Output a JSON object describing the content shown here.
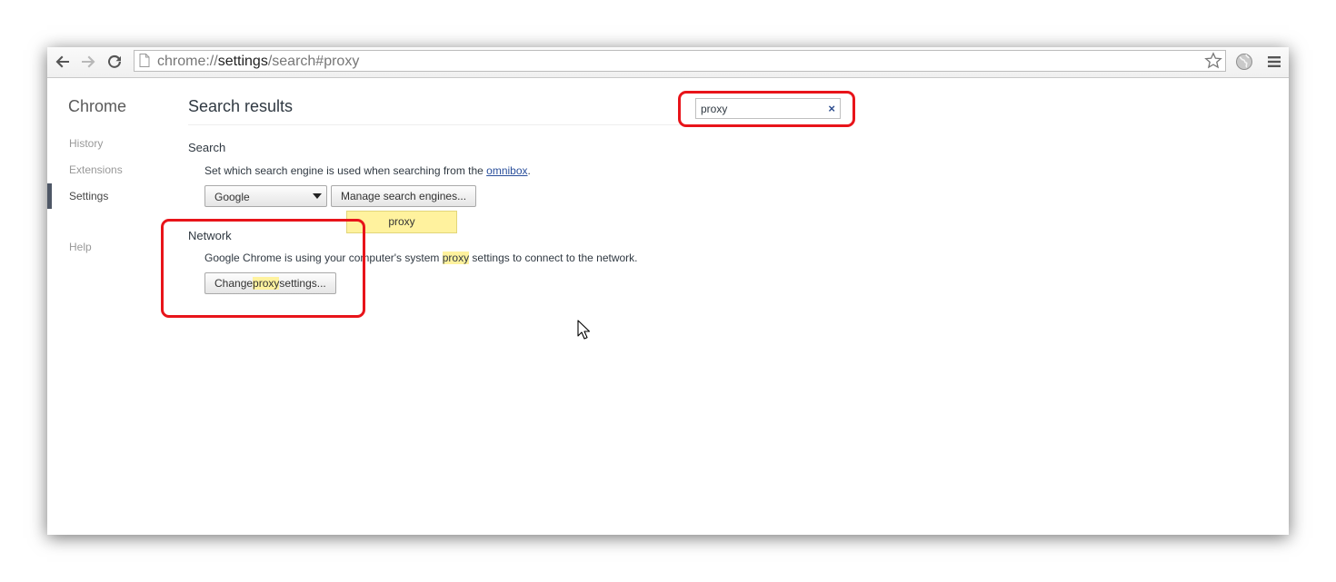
{
  "browser": {
    "url_scheme": "chrome://",
    "url_host": "settings",
    "url_path": "/search#proxy"
  },
  "sidebar": {
    "title": "Chrome",
    "items": [
      {
        "label": "History"
      },
      {
        "label": "Extensions"
      },
      {
        "label": "Settings",
        "selected": true
      },
      {
        "label": "Help"
      }
    ]
  },
  "main": {
    "title": "Search results",
    "search_value": "proxy",
    "clear_glyph": "×",
    "search_section": {
      "title": "Search",
      "desc_prefix": "Set which search engine is used when searching from the ",
      "desc_link": "omnibox",
      "desc_suffix": ".",
      "engine_selected": "Google",
      "manage_button": "Manage search engines...",
      "bubble_text": "proxy"
    },
    "network_section": {
      "title": "Network",
      "desc_prefix": "Google Chrome is using your computer's system ",
      "desc_highlight": "proxy",
      "desc_suffix": " settings to connect to the network.",
      "button_prefix": "Change ",
      "button_highlight": "proxy",
      "button_suffix": " settings..."
    }
  },
  "colors": {
    "annotation_red": "#e8141a",
    "highlight_yellow": "#fff29e",
    "link_blue": "#2a4f9b"
  }
}
